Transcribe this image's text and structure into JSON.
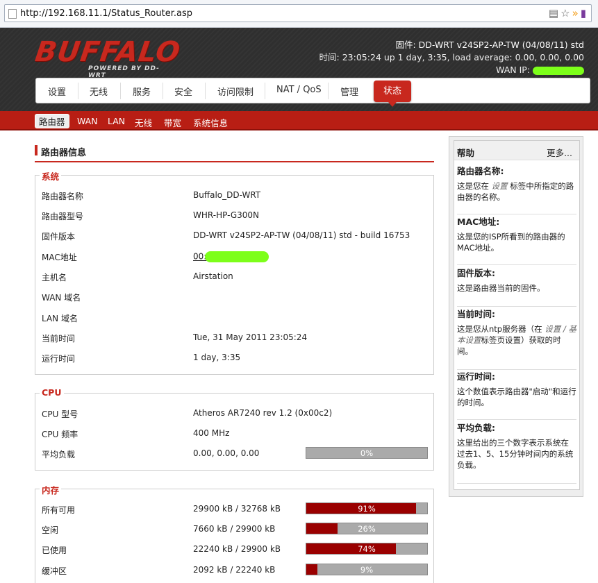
{
  "browser": {
    "url": "http://192.168.11.1/Status_Router.asp"
  },
  "header": {
    "logo_text": "BUFFALO",
    "logo_sub": "POWERED BY DD-WRT",
    "firmware_line": "固件: DD-WRT v24SP2-AP-TW (04/08/11) std",
    "time_line": "时间: 23:05:24 up 1 day, 3:35, load average: 0.00, 0.00, 0.00",
    "wan_ip_label": "WAN IP: "
  },
  "mainnav": {
    "items": [
      "设置",
      "无线",
      "服务",
      "安全",
      "访问限制",
      "NAT / QoS",
      "管理"
    ],
    "active": "状态"
  },
  "subnav": {
    "current": "路由器",
    "items": [
      "WAN",
      "LAN",
      "无线",
      "带宽",
      "系统信息"
    ]
  },
  "page": {
    "title": "路由器信息"
  },
  "system": {
    "legend": "系统",
    "rows": [
      {
        "label": "路由器名称",
        "value": "Buffalo_DD-WRT"
      },
      {
        "label": "路由器型号",
        "value": "WHR-HP-G300N"
      },
      {
        "label": "固件版本",
        "value": "DD-WRT v24SP2-AP-TW (04/08/11) std - build 16753"
      },
      {
        "label": "MAC地址",
        "value": "00:"
      },
      {
        "label": "主机名",
        "value": "Airstation"
      },
      {
        "label": "WAN 域名",
        "value": ""
      },
      {
        "label": "LAN 域名",
        "value": ""
      },
      {
        "label": "当前时间",
        "value": "Tue, 31 May 2011 23:05:24"
      },
      {
        "label": "运行时间",
        "value": "1 day, 3:35"
      }
    ]
  },
  "cpu": {
    "legend": "CPU",
    "rows": [
      {
        "label": "CPU 型号",
        "value": "Atheros AR7240 rev 1.2 (0x00c2)"
      },
      {
        "label": "CPU 频率",
        "value": "400 MHz"
      },
      {
        "label": "平均负载",
        "value": "0.00, 0.00, 0.00",
        "percent": 0,
        "percent_label": "0%"
      }
    ]
  },
  "memory": {
    "legend": "内存",
    "rows": [
      {
        "label": "所有可用",
        "value": "29900 kB / 32768 kB",
        "percent": 91,
        "percent_label": "91%"
      },
      {
        "label": "空闲",
        "value": "7660 kB / 29900 kB",
        "percent": 26,
        "percent_label": "26%"
      },
      {
        "label": "已使用",
        "value": "22240 kB / 29900 kB",
        "percent": 74,
        "percent_label": "74%"
      },
      {
        "label": "缓冲区",
        "value": "2092 kB / 22240 kB",
        "percent": 9,
        "percent_label": "9%"
      }
    ]
  },
  "help": {
    "title": "帮助",
    "more": "更多...",
    "sections": [
      {
        "title": "路由器名称:",
        "text_a": "这是您在 ",
        "text_em": "设置",
        "text_b": " 标签中所指定的路由器的名称。"
      },
      {
        "title": "MAC地址:",
        "text_a": "这是您的ISP所看到的路由器的MAC地址。",
        "text_em": "",
        "text_b": ""
      },
      {
        "title": "固件版本:",
        "text_a": "这是路由器当前的固件。",
        "text_em": "",
        "text_b": ""
      },
      {
        "title": "当前时间:",
        "text_a": "这是您从ntp服务器（在 ",
        "text_em": "设置 / 基本设置",
        "text_b": "标签页设置）获取的时间。"
      },
      {
        "title": "运行时间:",
        "text_a": "这个数值表示路由器\"启动\"和运行的时间。",
        "text_em": "",
        "text_b": ""
      },
      {
        "title": "平均负载:",
        "text_a": "这里给出的三个数字表示系统在过去1、5、15分钟时间内的系统负载。",
        "text_em": "",
        "text_b": ""
      }
    ]
  },
  "colors": {
    "brand_red": "#c8281e",
    "bar_fill": "#9a0000",
    "bar_bg": "#aaaaaa",
    "redaction_green": "#7dff1a"
  }
}
